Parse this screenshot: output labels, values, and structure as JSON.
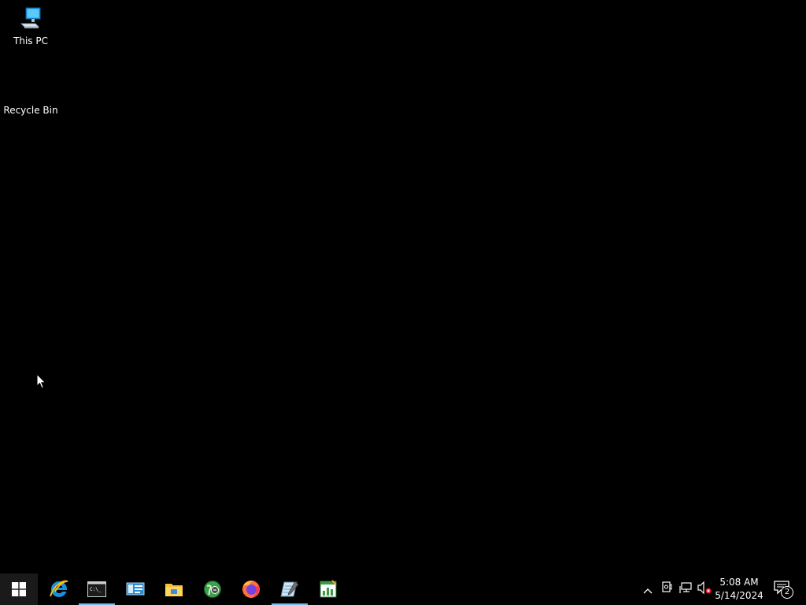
{
  "desktop": {
    "background_color": "#000000",
    "icons": [
      {
        "label": "This PC",
        "icon": "this-pc-icon"
      },
      {
        "label": "Recycle Bin",
        "icon": "recycle-bin-icon"
      }
    ]
  },
  "taskbar": {
    "background_color": "#000000",
    "accent_color": "#76b9ed",
    "start": {
      "icon": "windows-logo-icon"
    },
    "pinned_apps": [
      {
        "name": "Internet Explorer",
        "icon": "internet-explorer-icon",
        "running": false
      },
      {
        "name": "Command Prompt",
        "icon": "command-prompt-icon",
        "running": true
      },
      {
        "name": "Server Manager",
        "icon": "server-manager-icon",
        "running": false
      },
      {
        "name": "File Explorer",
        "icon": "file-explorer-icon",
        "running": false
      },
      {
        "name": "Network Globe",
        "icon": "globe-icon",
        "running": false
      },
      {
        "name": "Firefox",
        "icon": "firefox-icon",
        "running": false
      },
      {
        "name": "Text Editor",
        "icon": "notepad-icon",
        "running": true
      },
      {
        "name": "Spreadsheet",
        "icon": "spreadsheet-icon",
        "running": false
      }
    ],
    "tray": {
      "icons": [
        "show-hidden-icons-chevron-icon",
        "webcam-icon",
        "network-icon",
        "volume-muted-icon"
      ],
      "time": "5:08 AM",
      "date": "5/14/2024",
      "notification_count": "2"
    }
  }
}
